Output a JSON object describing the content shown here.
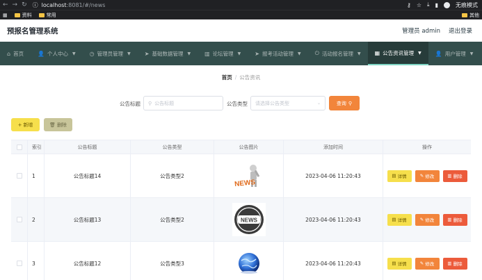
{
  "browser": {
    "url_host": "localhost",
    "url_path": ":8081/#/news",
    "incognito_label": "无痕模式",
    "bookmarks": [
      "资料",
      "常用"
    ],
    "bookmarks_right": "其他"
  },
  "header": {
    "title": "预报名管理系统",
    "user": "管理员 admin",
    "logout": "退出登录"
  },
  "nav": {
    "items": [
      {
        "label": "首页",
        "icon": "home-icon",
        "has_menu": false
      },
      {
        "label": "个人中心",
        "icon": "user-icon",
        "has_menu": true
      },
      {
        "label": "管理员管理",
        "icon": "clock-icon",
        "has_menu": true
      },
      {
        "label": "基础数据管理",
        "icon": "send-icon",
        "has_menu": true
      },
      {
        "label": "论坛管理",
        "icon": "trash-icon",
        "has_menu": true
      },
      {
        "label": "报考活动管理",
        "icon": "send-icon",
        "has_menu": true
      },
      {
        "label": "活动报名管理",
        "icon": "power-icon",
        "has_menu": true
      },
      {
        "label": "公告资讯管理",
        "icon": "grid-icon",
        "has_menu": true,
        "active": true
      },
      {
        "label": "用户管理",
        "icon": "user-icon",
        "has_menu": true
      }
    ]
  },
  "breadcrumb": {
    "home": "首页",
    "separator": "/",
    "current": "公告资讯"
  },
  "search": {
    "title_label": "公告标题",
    "title_placeholder": "公告标题",
    "type_label": "公告类型",
    "type_placeholder": "请选择公告类型",
    "query_button": "查询"
  },
  "actions": {
    "add": "新增",
    "delete": "删除"
  },
  "table": {
    "columns": [
      "索引",
      "公告标题",
      "公告类型",
      "公告图片",
      "添加时间",
      "操作"
    ],
    "row_actions": {
      "detail": "详情",
      "edit": "修改",
      "delete": "删除"
    },
    "rows": [
      {
        "index": "1",
        "title": "公告标题14",
        "type": "公告类型2",
        "image": "news-figure-image",
        "time": "2023-04-06 11:20:43"
      },
      {
        "index": "2",
        "title": "公告标题13",
        "type": "公告类型2",
        "image": "news-circle-image",
        "time": "2023-04-06 11:20:43"
      },
      {
        "index": "3",
        "title": "公告标题12",
        "type": "公告类型3",
        "image": "news-globe-image",
        "time": "2023-04-06 11:20:43"
      }
    ],
    "news_logo_text": "NEWS"
  }
}
